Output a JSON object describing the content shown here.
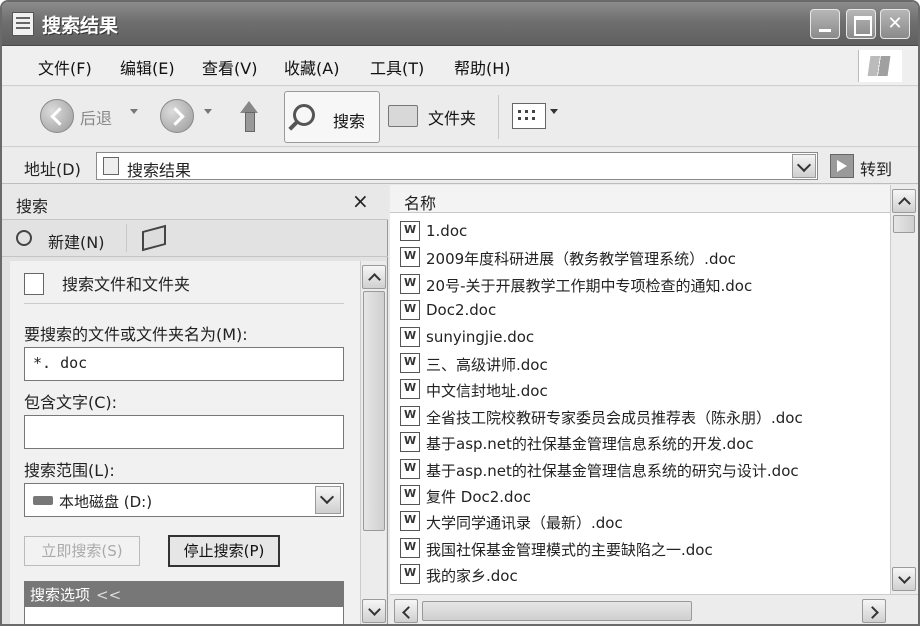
{
  "window": {
    "title": "搜索结果"
  },
  "menu": [
    "文件(F)",
    "编辑(E)",
    "查看(V)",
    "收藏(A)",
    "工具(T)",
    "帮助(H)"
  ],
  "toolbar": {
    "back": "后退",
    "search": "搜索",
    "folders": "文件夹"
  },
  "address": {
    "label": "地址(D)",
    "value": "搜索结果",
    "go": "转到"
  },
  "search_pane": {
    "title": "搜索",
    "close": "×",
    "new_label": "新建(N)",
    "heading": "搜索文件和文件夹",
    "name_label": "要搜索的文件或文件夹名为(M):",
    "name_value": "*. doc",
    "text_label": "包含文字(C):",
    "text_value": "",
    "scope_label": "搜索范围(L):",
    "scope_value": "本地磁盘   (D:)",
    "search_now": "立即搜索(S)",
    "stop_search": "停止搜索(P)",
    "options": "搜索选项",
    "options_chevron": "<<"
  },
  "results": {
    "column": "名称",
    "items": [
      "1.doc",
      "2009年度科研进展（教务教学管理系统）.doc",
      "20号-关于开展教学工作期中专项检查的通知.doc",
      "Doc2.doc",
      "sunyingjie.doc",
      "三、高级讲师.doc",
      "中文信封地址.doc",
      "全省技工院校教研专家委员会成员推荐表（陈永朋）.doc",
      "基于asp.net的社保基金管理信息系统的开发.doc",
      "基于asp.net的社保基金管理信息系统的研究与设计.doc",
      "复件 Doc2.doc",
      "大学同学通讯录（最新）.doc",
      "我国社保基金管理模式的主要缺陷之一.doc",
      "我的家乡.doc"
    ]
  }
}
